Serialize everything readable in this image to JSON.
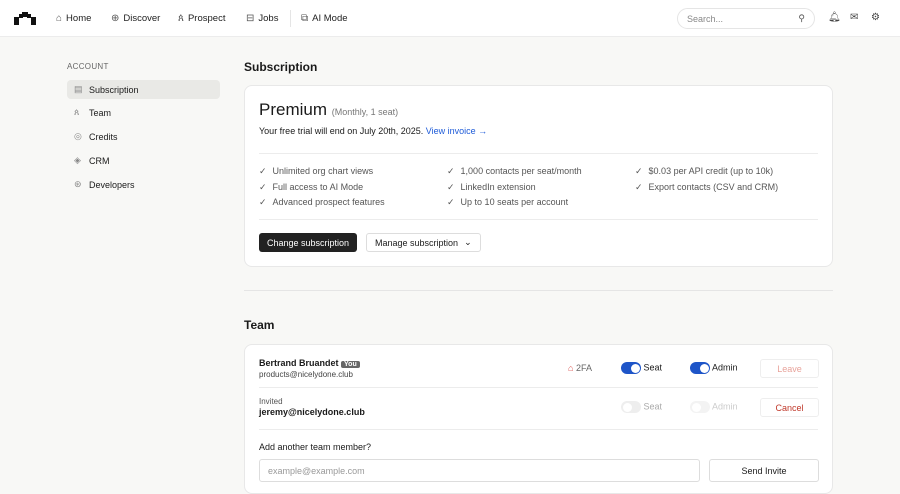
{
  "nav": {
    "items": [
      {
        "label": "Home",
        "icon": "home-icon"
      },
      {
        "label": "Discover",
        "icon": "globe-icon"
      },
      {
        "label": "Prospect",
        "icon": "users-icon"
      },
      {
        "label": "Jobs",
        "icon": "briefcase-icon"
      },
      {
        "label": "AI Mode",
        "icon": "ai-icon"
      }
    ],
    "search_placeholder": "Search..."
  },
  "sidebar": {
    "heading": "ACCOUNT",
    "items": [
      {
        "label": "Subscription"
      },
      {
        "label": "Team"
      },
      {
        "label": "Credits"
      },
      {
        "label": "CRM"
      },
      {
        "label": "Developers"
      }
    ]
  },
  "subscription": {
    "title": "Subscription",
    "plan": "Premium",
    "plan_detail": "(Monthly, 1 seat)",
    "trial_text": "Your free trial will end on July 20th, 2025.",
    "invoice_link": "View invoice →",
    "features": [
      "Unlimited org chart views",
      "Full access to AI Mode",
      "Advanced prospect features",
      "1,000 contacts per seat/month",
      "LinkedIn extension",
      "Up to 10 seats per account",
      "$0.03 per API credit (up to 10k)",
      "Export contacts (CSV and CRM)"
    ],
    "change_btn": "Change subscription",
    "manage_btn": "Manage subscription"
  },
  "team": {
    "title": "Team",
    "members": [
      {
        "name": "Bertrand Bruandet",
        "badge": "You",
        "email": "products@nicelydone.club",
        "twofa": "2FA",
        "seat": "Seat",
        "admin": "Admin",
        "action": "Leave"
      },
      {
        "status": "Invited",
        "email": "jeremy@nicelydone.club",
        "seat": "Seat",
        "admin": "Admin",
        "action": "Cancel"
      }
    ],
    "add_label": "Add another team member?",
    "email_placeholder": "example@example.com",
    "send_btn": "Send Invite"
  },
  "colors": {
    "accent": "#1e55c8",
    "danger": "#c0392b"
  }
}
